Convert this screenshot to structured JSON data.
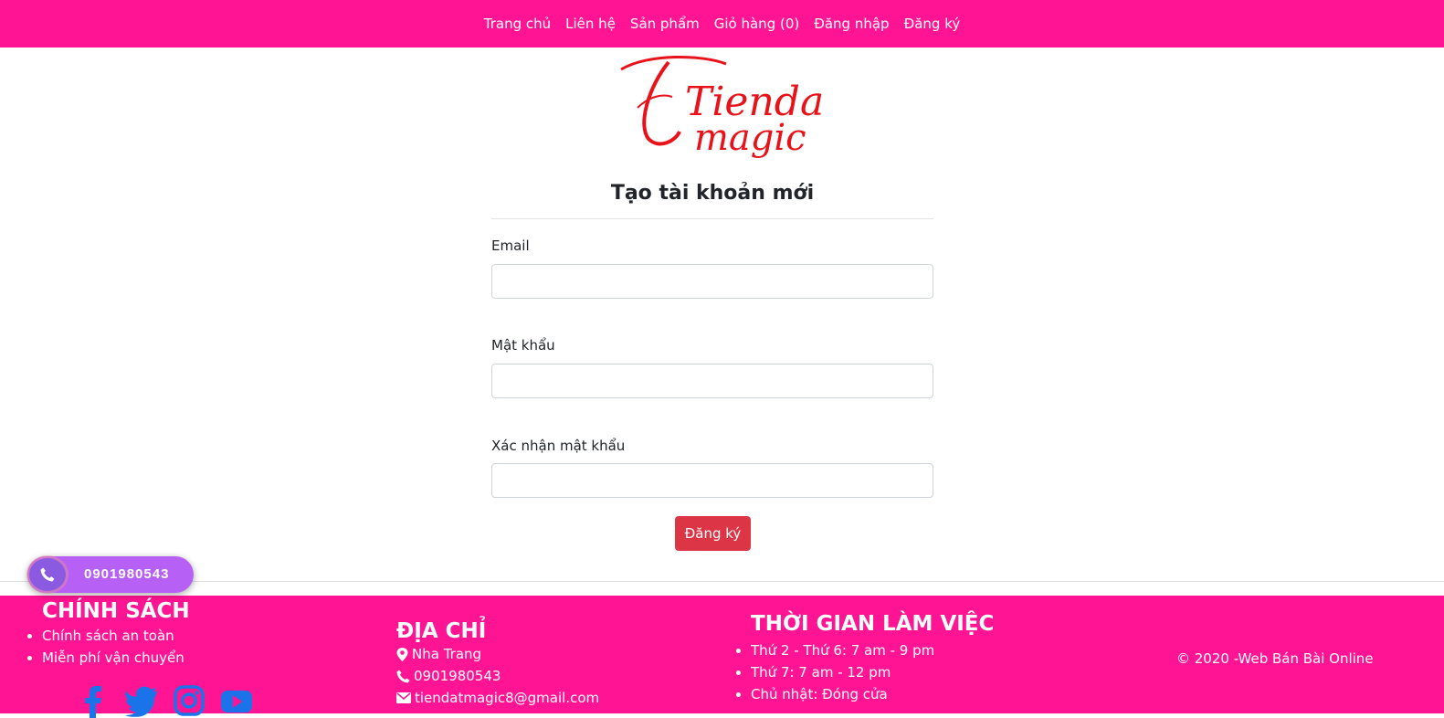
{
  "nav": {
    "items": [
      "Trang chủ",
      "Liên hệ",
      "Sản phẩm",
      "Giỏ hàng (0)",
      "Đăng nhập",
      "Đăng ký"
    ]
  },
  "logo": {
    "line1": "Tiendat",
    "line2": "magic"
  },
  "form": {
    "title": "Tạo tài khoản mới",
    "email_label": "Email",
    "email_value": "",
    "password_label": "Mật khẩu",
    "password_value": "",
    "confirm_label": "Xác nhận mật khẩu",
    "confirm_value": "",
    "submit_label": "Đăng ký"
  },
  "call_widget": {
    "phone": "0901980543"
  },
  "footer": {
    "policy": {
      "title": "CHÍNH SÁCH",
      "items": [
        "Chính sách an toàn",
        "Miễn phí vận chuyển"
      ]
    },
    "address": {
      "title": "ĐỊA CHỈ",
      "location": "Nha Trang",
      "phone": "0901980543",
      "email": "tiendatmagic8@gmail.com"
    },
    "hours": {
      "title": "THỜI GIAN LÀM VIỆC",
      "items": [
        "Thứ 2 - Thứ 6: 7 am - 9 pm",
        "Thứ 7: 7 am - 12 pm",
        "Chủ nhật: Đóng cửa"
      ]
    },
    "copyright": "© 2020 -Web Bán Bài Online"
  },
  "colors": {
    "brand": "#ff1493",
    "submit": "#dc3545",
    "social": "#1a73e8",
    "call": "#b760f5",
    "logo": "#e8131a"
  },
  "icons": [
    "map-marker-icon",
    "phone-icon",
    "envelope-icon",
    "facebook-icon",
    "twitter-icon",
    "instagram-icon",
    "youtube-icon"
  ]
}
